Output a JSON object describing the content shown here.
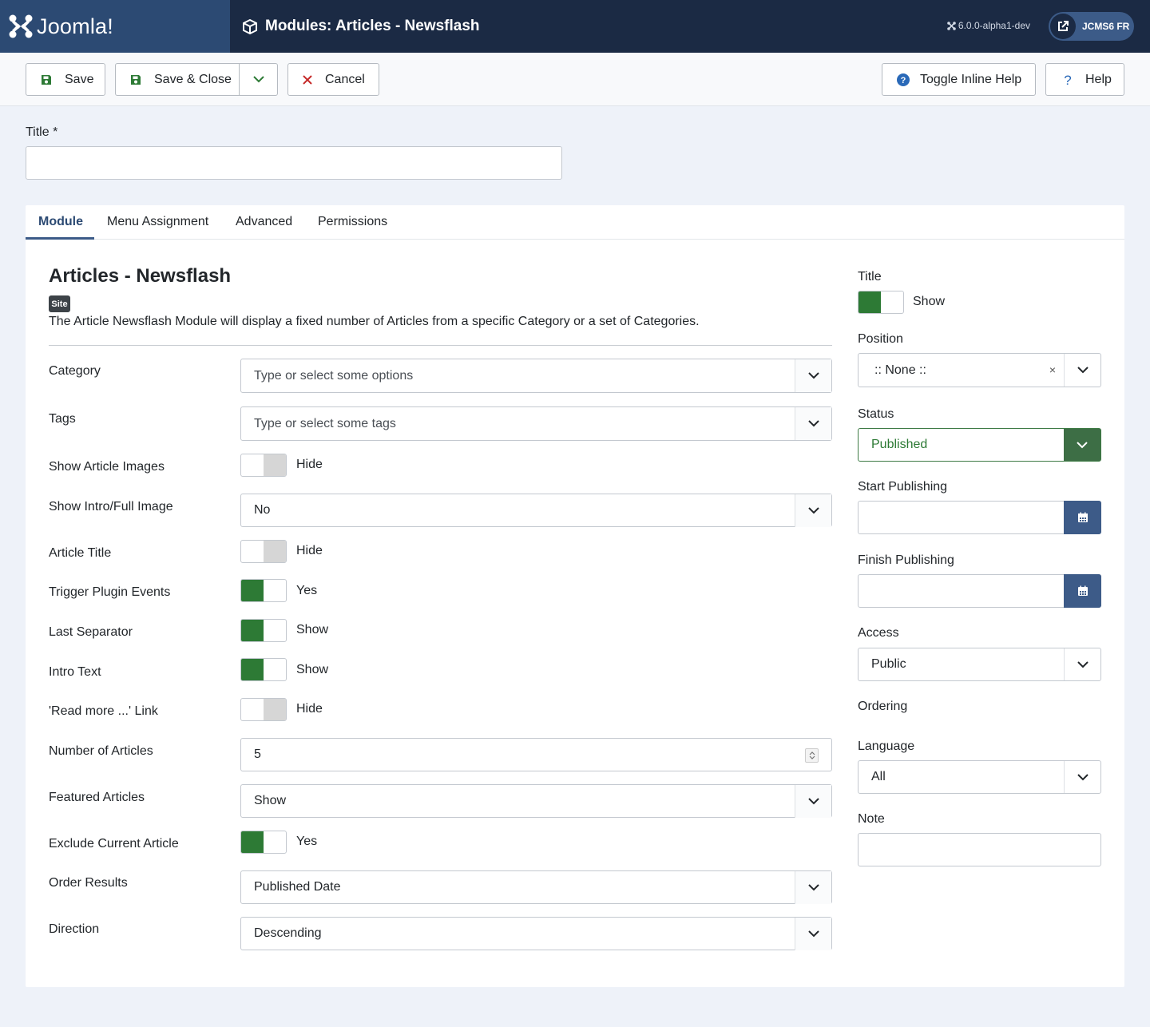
{
  "header": {
    "brand": "Joomla!",
    "page_title": "Modules: Articles - Newsflash",
    "version": "6.0.0-alpha1-dev",
    "site_name": "JCMS6 FR"
  },
  "toolbar": {
    "save_label": "Save",
    "save_close_label": "Save & Close",
    "cancel_label": "Cancel",
    "inline_help_label": "Toggle Inline Help",
    "help_label": "Help"
  },
  "title_field": {
    "label": "Title *",
    "value": ""
  },
  "tabs": [
    {
      "label": "Module",
      "active": true
    },
    {
      "label": "Menu Assignment",
      "active": false
    },
    {
      "label": "Advanced",
      "active": false
    },
    {
      "label": "Permissions",
      "active": false
    }
  ],
  "module": {
    "heading": "Articles - Newsflash",
    "badge": "Site",
    "description": "The Article Newsflash Module will display a fixed number of Articles from a specific Category or a set of Categories."
  },
  "fields": {
    "category": {
      "label": "Category",
      "placeholder": "Type or select some options"
    },
    "tags": {
      "label": "Tags",
      "placeholder": "Type or select some tags"
    },
    "show_article_images": {
      "label": "Show Article Images",
      "state": "Hide",
      "on": false
    },
    "show_intro_full_image": {
      "label": "Show Intro/Full Image",
      "value": "No"
    },
    "article_title": {
      "label": "Article Title",
      "state": "Hide",
      "on": false
    },
    "trigger_plugin_events": {
      "label": "Trigger Plugin Events",
      "state": "Yes",
      "on": true
    },
    "last_separator": {
      "label": "Last Separator",
      "state": "Show",
      "on": true
    },
    "intro_text": {
      "label": "Intro Text",
      "state": "Show",
      "on": true
    },
    "read_more_link": {
      "label": "'Read more ...' Link",
      "state": "Hide",
      "on": false
    },
    "number_of_articles": {
      "label": "Number of Articles",
      "value": "5"
    },
    "featured_articles": {
      "label": "Featured Articles",
      "value": "Show"
    },
    "exclude_current_article": {
      "label": "Exclude Current Article",
      "state": "Yes",
      "on": true
    },
    "order_results": {
      "label": "Order Results",
      "value": "Published Date"
    },
    "direction": {
      "label": "Direction",
      "value": "Descending"
    }
  },
  "sidebar": {
    "title_label": "Title",
    "title_state": "Show",
    "position_label": "Position",
    "position_value": ":: None ::",
    "status_label": "Status",
    "status_value": "Published",
    "start_publishing_label": "Start Publishing",
    "finish_publishing_label": "Finish Publishing",
    "access_label": "Access",
    "access_value": "Public",
    "ordering_label": "Ordering",
    "language_label": "Language",
    "language_value": "All",
    "note_label": "Note"
  },
  "colors": {
    "header_bg": "#1b2a44",
    "brand_bg": "#2c4a73",
    "toggle_on": "#2d7a35",
    "status_green": "#3d6e45",
    "calendar_btn": "#3d5b88"
  }
}
